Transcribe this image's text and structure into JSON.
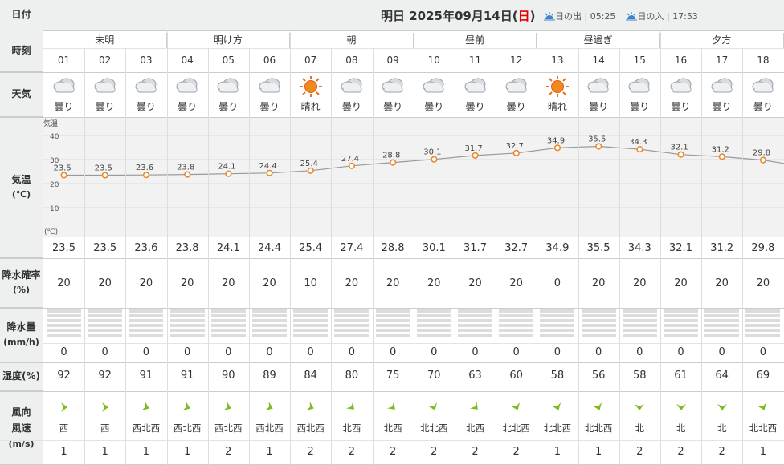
{
  "row_labels": {
    "date": "日付",
    "time": "時刻",
    "weather": "天気",
    "temp": "気温",
    "temp_unit": "(℃)",
    "precip_prob": "降水確率",
    "precip_prob_unit": "(%)",
    "precip_amount": "降水量",
    "precip_amount_unit": "(mm/h)",
    "humidity": "湿度(%)",
    "wind_dir": "風向",
    "wind_speed": "風速",
    "wind_unit": "(m/s)"
  },
  "header": {
    "day_label": "明日",
    "date_text": "2025年09月14日(",
    "weekday": "日",
    "date_close": ")",
    "sunrise_label": "日の出",
    "sunrise_time": "05:25",
    "sunset_label": "日の入",
    "sunset_time": "17:53"
  },
  "periods": [
    "未明",
    "明け方",
    "朝",
    "昼前",
    "昼過ぎ",
    "夕方"
  ],
  "colors": {
    "sunday": "#e60000",
    "line": "#999999",
    "dot": "#e88a2a",
    "label_bg": "#eef0ef",
    "chart_bg": "#f2f2f2"
  },
  "hours": [
    {
      "time": "01",
      "weather": "曇り",
      "icon": "cloud-icon",
      "temp": "23.5",
      "prob": "20",
      "rain": "0",
      "hum": "92",
      "dir": "西",
      "wdeg": 90,
      "speed": "1"
    },
    {
      "time": "02",
      "weather": "曇り",
      "icon": "cloud-icon",
      "temp": "23.5",
      "prob": "20",
      "rain": "0",
      "hum": "92",
      "dir": "西",
      "wdeg": 90,
      "speed": "1"
    },
    {
      "time": "03",
      "weather": "曇り",
      "icon": "cloud-icon",
      "temp": "23.6",
      "prob": "20",
      "rain": "0",
      "hum": "91",
      "dir": "西北西",
      "wdeg": 112,
      "speed": "1"
    },
    {
      "time": "04",
      "weather": "曇り",
      "icon": "cloud-icon",
      "temp": "23.8",
      "prob": "20",
      "rain": "0",
      "hum": "91",
      "dir": "西北西",
      "wdeg": 112,
      "speed": "1"
    },
    {
      "time": "05",
      "weather": "曇り",
      "icon": "cloud-icon",
      "temp": "24.1",
      "prob": "20",
      "rain": "0",
      "hum": "90",
      "dir": "西北西",
      "wdeg": 112,
      "speed": "2"
    },
    {
      "time": "06",
      "weather": "曇り",
      "icon": "cloud-icon",
      "temp": "24.4",
      "prob": "20",
      "rain": "0",
      "hum": "89",
      "dir": "西北西",
      "wdeg": 112,
      "speed": "1"
    },
    {
      "time": "07",
      "weather": "晴れ",
      "icon": "sun-icon",
      "temp": "25.4",
      "prob": "10",
      "rain": "0",
      "hum": "84",
      "dir": "西北西",
      "wdeg": 112,
      "speed": "2"
    },
    {
      "time": "08",
      "weather": "曇り",
      "icon": "cloud-icon",
      "temp": "27.4",
      "prob": "20",
      "rain": "0",
      "hum": "80",
      "dir": "北西",
      "wdeg": 135,
      "speed": "2"
    },
    {
      "time": "09",
      "weather": "曇り",
      "icon": "cloud-icon",
      "temp": "28.8",
      "prob": "20",
      "rain": "0",
      "hum": "75",
      "dir": "北西",
      "wdeg": 135,
      "speed": "2"
    },
    {
      "time": "10",
      "weather": "曇り",
      "icon": "cloud-icon",
      "temp": "30.1",
      "prob": "20",
      "rain": "0",
      "hum": "70",
      "dir": "北北西",
      "wdeg": 158,
      "speed": "2"
    },
    {
      "time": "11",
      "weather": "曇り",
      "icon": "cloud-icon",
      "temp": "31.7",
      "prob": "20",
      "rain": "0",
      "hum": "63",
      "dir": "北西",
      "wdeg": 135,
      "speed": "2"
    },
    {
      "time": "12",
      "weather": "曇り",
      "icon": "cloud-icon",
      "temp": "32.7",
      "prob": "20",
      "rain": "0",
      "hum": "60",
      "dir": "北北西",
      "wdeg": 158,
      "speed": "2"
    },
    {
      "time": "13",
      "weather": "晴れ",
      "icon": "sun-icon",
      "temp": "34.9",
      "prob": "0",
      "rain": "0",
      "hum": "58",
      "dir": "北北西",
      "wdeg": 158,
      "speed": "1"
    },
    {
      "time": "14",
      "weather": "曇り",
      "icon": "cloud-icon",
      "temp": "35.5",
      "prob": "20",
      "rain": "0",
      "hum": "56",
      "dir": "北北西",
      "wdeg": 158,
      "speed": "1"
    },
    {
      "time": "15",
      "weather": "曇り",
      "icon": "cloud-icon",
      "temp": "34.3",
      "prob": "20",
      "rain": "0",
      "hum": "58",
      "dir": "北",
      "wdeg": 180,
      "speed": "2"
    },
    {
      "time": "16",
      "weather": "曇り",
      "icon": "cloud-icon",
      "temp": "32.1",
      "prob": "20",
      "rain": "0",
      "hum": "61",
      "dir": "北",
      "wdeg": 180,
      "speed": "2"
    },
    {
      "time": "17",
      "weather": "曇り",
      "icon": "cloud-icon",
      "temp": "31.2",
      "prob": "20",
      "rain": "0",
      "hum": "64",
      "dir": "北",
      "wdeg": 180,
      "speed": "2"
    },
    {
      "time": "18",
      "weather": "曇り",
      "icon": "cloud-icon",
      "temp": "29.8",
      "prob": "20",
      "rain": "0",
      "hum": "69",
      "dir": "北北西",
      "wdeg": 158,
      "speed": "1"
    }
  ],
  "chart_data": {
    "type": "line",
    "ylabel": "気温",
    "yunit": "(℃)",
    "x": [
      "01",
      "02",
      "03",
      "04",
      "05",
      "06",
      "07",
      "08",
      "09",
      "10",
      "11",
      "12",
      "13",
      "14",
      "15",
      "16",
      "17",
      "18"
    ],
    "yticks": [
      "40",
      "30",
      "20",
      "10"
    ],
    "ylim": [
      0,
      45
    ],
    "grid": true,
    "series": [
      {
        "values": [
          23.5,
          23.5,
          23.6,
          23.8,
          24.1,
          24.4,
          25.4,
          27.4,
          28.8,
          30.1,
          31.7,
          32.7,
          34.9,
          35.5,
          34.3,
          32.1,
          31.2,
          29.8
        ]
      }
    ]
  }
}
